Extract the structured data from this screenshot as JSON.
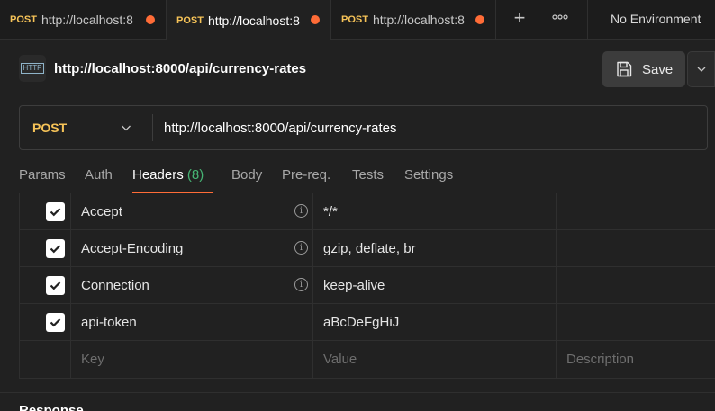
{
  "tabs": [
    {
      "method": "POST",
      "url": "http://localhost:8",
      "unsaved": true,
      "active": false
    },
    {
      "method": "POST",
      "url": "http://localhost:8",
      "unsaved": true,
      "active": true
    },
    {
      "method": "POST",
      "url": "http://localhost:8",
      "unsaved": true,
      "active": false
    }
  ],
  "tabbar": {
    "new_tab_icon": "plus-icon",
    "more_icon": "ellipsis-icon"
  },
  "environment": {
    "label": "No Environment"
  },
  "request": {
    "icon_text": "HTTP",
    "title": "http://localhost:8000/api/currency-rates",
    "save_label": "Save",
    "method": "POST",
    "url": "http://localhost:8000/api/currency-rates"
  },
  "subtabs": {
    "params": "Params",
    "auth": "Auth",
    "headers": "Headers",
    "headers_count": "(8)",
    "body": "Body",
    "prereq": "Pre-req.",
    "tests": "Tests",
    "settings": "Settings"
  },
  "headers": {
    "rows": [
      {
        "key": "Accept",
        "value": "*/*",
        "checked": true,
        "info": true
      },
      {
        "key": "Accept-Encoding",
        "value": "gzip, deflate, br",
        "checked": true,
        "info": true
      },
      {
        "key": "Connection",
        "value": "keep-alive",
        "checked": true,
        "info": true
      },
      {
        "key": "api-token",
        "value": "aBcDeFgHiJ",
        "checked": true,
        "info": false
      }
    ],
    "placeholders": {
      "key": "Key",
      "value": "Value",
      "description": "Description"
    }
  },
  "response": {
    "label": "Response"
  },
  "colors": {
    "accent": "#ff6c37",
    "method_post": "#f6c358",
    "count_green": "#46b474",
    "background": "#212121"
  }
}
